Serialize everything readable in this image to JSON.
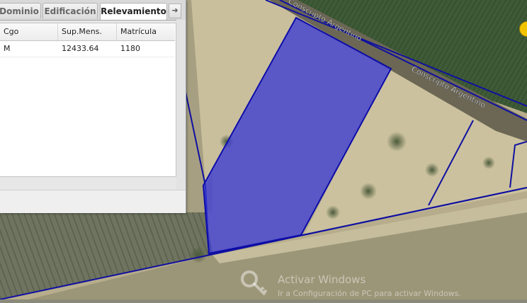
{
  "tabs": [
    {
      "label": "Dominio",
      "active": false
    },
    {
      "label": "Edificación",
      "active": false
    },
    {
      "label": "Relevamiento",
      "active": true
    }
  ],
  "tab_scroll_icon": "arrow-right-icon",
  "table": {
    "columns": [
      "Cgo",
      "Sup.Mens.",
      "Matrícula"
    ],
    "rows": [
      {
        "cgo": "M",
        "sup_mens": "12433.64",
        "matricula": "1180"
      }
    ]
  },
  "map": {
    "street_labels": [
      "Conscripto Argentino",
      "Conscripto Argentino"
    ],
    "parcel_color": "#1a1aa6",
    "selected_fill": "#3a3ae6",
    "zoom_control_icon": "map-control-icon"
  },
  "watermark": {
    "title": "Activar Windows",
    "subtitle": "Ir a Configuración de PC para activar Windows."
  }
}
